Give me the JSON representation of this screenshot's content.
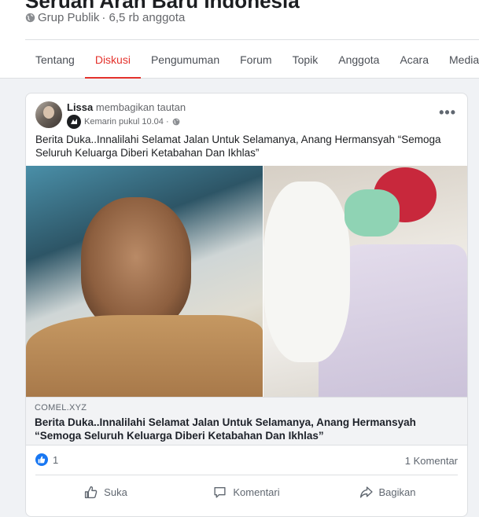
{
  "group": {
    "title": "Seruan Arah Baru Indonesia",
    "privacy": "Grup Publik",
    "members": "· 6,5 rb anggota"
  },
  "tabs": [
    {
      "label": "Tentang"
    },
    {
      "label": "Diskusi",
      "active": true
    },
    {
      "label": "Pengumuman"
    },
    {
      "label": "Forum"
    },
    {
      "label": "Topik"
    },
    {
      "label": "Anggota"
    },
    {
      "label": "Acara"
    },
    {
      "label": "Media"
    }
  ],
  "post": {
    "author": "Lissa",
    "action": "membagikan tautan",
    "time": "Kemarin pukul 10.04 ·",
    "text": "Berita Duka..Innalilahi Selamat Jalan Untuk Selamanya, Anang Hermansyah “Semoga Seluruh Keluarga Diberi Ketabahan Dan Ikhlas”",
    "more_icon": "more-dots-icon",
    "link": {
      "domain": "COMEL.XYZ",
      "title": "Berita Duka..Innalilahi Selamat Jalan Untuk Selamanya, Anang Hermansyah “Semoga Seluruh Keluarga Diberi Ketabahan Dan Ikhlas”"
    },
    "info_icon": "i",
    "reactions_count": "1",
    "comments": "1 Komentar",
    "actions": {
      "like": "Suka",
      "comment": "Komentari",
      "share": "Bagikan"
    }
  },
  "colors": {
    "accent": "#e4322c",
    "like_blue": "#1877f2"
  }
}
